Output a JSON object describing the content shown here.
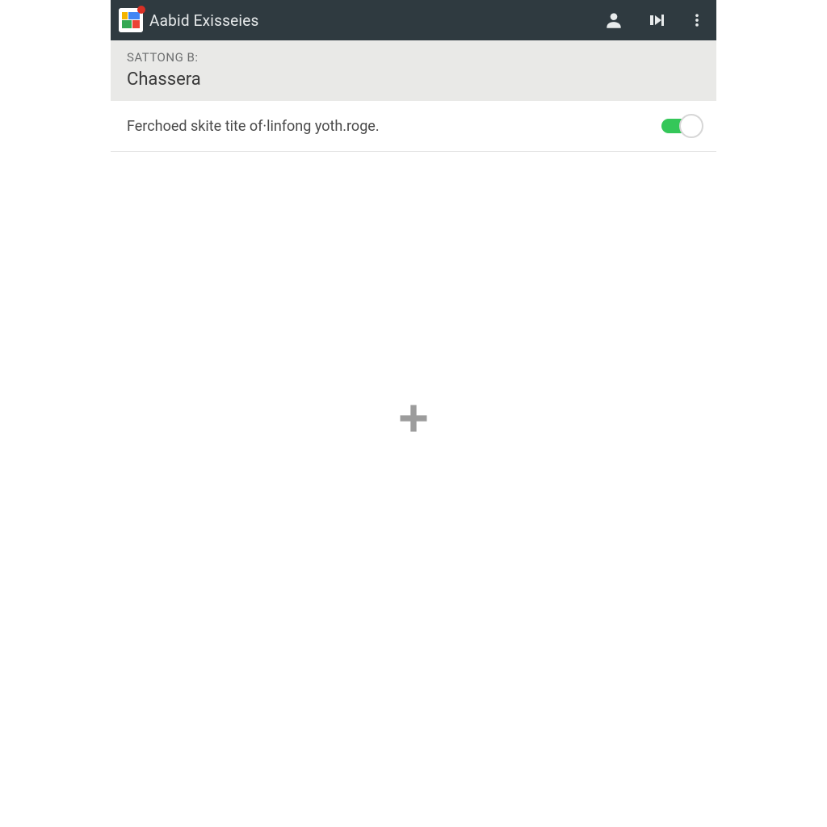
{
  "header": {
    "app_title": "Aabid Exisseies"
  },
  "section": {
    "label": "SATTONG B:",
    "title": "Chassera"
  },
  "setting": {
    "description": "Ferchoed skite tite of·linfong yoth.roge.",
    "toggle_on": true
  },
  "colors": {
    "action_bar": "#2f3a40",
    "section_bg": "#e9e9e7",
    "toggle_on": "#34c759"
  }
}
